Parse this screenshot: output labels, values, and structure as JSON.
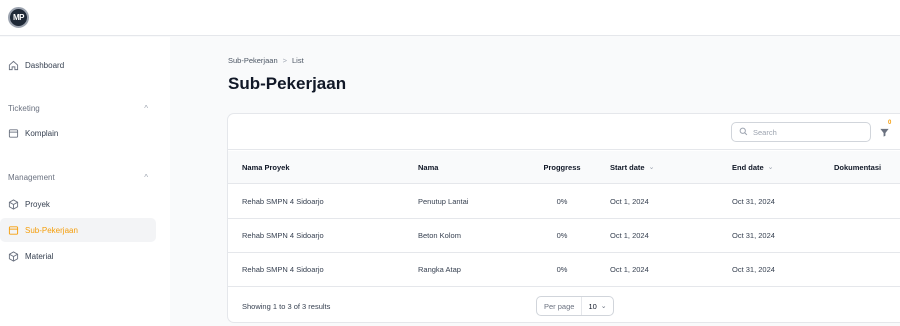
{
  "app": {
    "logo_text": "MP"
  },
  "sidebar": {
    "dashboard": "Dashboard",
    "groups": [
      {
        "label": "Ticketing",
        "items": [
          "Komplain"
        ]
      },
      {
        "label": "Management",
        "items": [
          "Proyek",
          "Sub-Pekerjaan",
          "Material"
        ]
      }
    ],
    "active_item": "Sub-Pekerjaan",
    "accent_color": "#f59e0b"
  },
  "breadcrumb": {
    "parent": "Sub-Pekerjaan",
    "separator": ">",
    "current": "List"
  },
  "page_title": "Sub-Pekerjaan",
  "search": {
    "placeholder": "Search",
    "value": ""
  },
  "filter": {
    "badge": "0"
  },
  "table": {
    "columns": [
      "Nama Proyek",
      "Nama",
      "Proggress",
      "Start date",
      "End date",
      "Dokumentasi"
    ],
    "rows": [
      {
        "nama_proyek": "Rehab SMPN 4 Sidoarjo",
        "nama": "Penutup Lantai",
        "progress": "0%",
        "start": "Oct 1, 2024",
        "end": "Oct 31, 2024",
        "dokumentasi": ""
      },
      {
        "nama_proyek": "Rehab SMPN 4 Sidoarjo",
        "nama": "Beton Kolom",
        "progress": "0%",
        "start": "Oct 1, 2024",
        "end": "Oct 31, 2024",
        "dokumentasi": ""
      },
      {
        "nama_proyek": "Rehab SMPN 4 Sidoarjo",
        "nama": "Rangka Atap",
        "progress": "0%",
        "start": "Oct 1, 2024",
        "end": "Oct 31, 2024",
        "dokumentasi": ""
      }
    ]
  },
  "footer": {
    "showing": "Showing 1 to 3 of 3 results",
    "per_page_label": "Per page",
    "per_page_value": "10"
  },
  "icons": [
    "home-icon",
    "inbox-icon",
    "cube-icon",
    "inbox-icon",
    "cube-icon",
    "search-icon",
    "filter-icon",
    "chevron-up-icon",
    "chevron-down-icon"
  ]
}
